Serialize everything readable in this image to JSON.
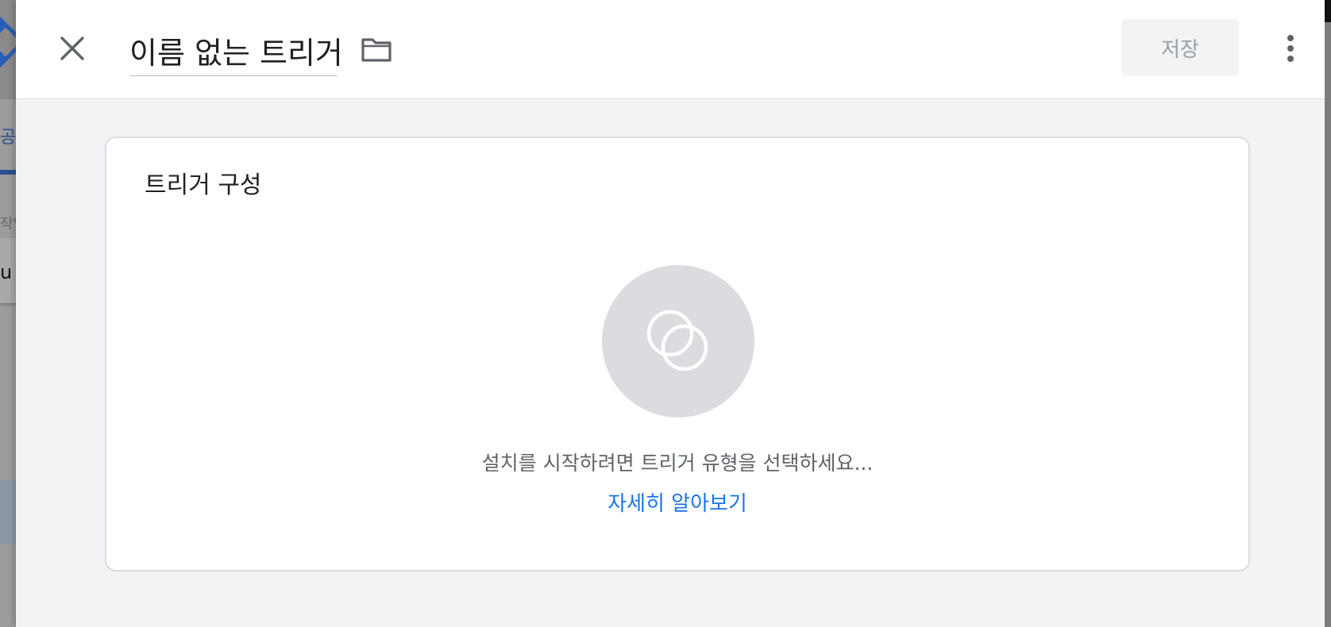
{
  "background": {
    "tab_fragment": "공",
    "label_fragment": "작업",
    "card_fragment": "u"
  },
  "header": {
    "close_icon": "close-icon",
    "title": "이름 없는 트리거",
    "folder_icon": "folder-icon",
    "save_label": "저장",
    "more_icon": "more-vert-icon"
  },
  "trigger_config": {
    "title": "트리거 구성",
    "empty_icon": "trigger-icon",
    "hint": "설치를 시작하려면 트리거 유형을 선택하세요...",
    "learn_more": "자세히 알아보기"
  },
  "colors": {
    "accent": "#1a73e8",
    "panel_bg": "#f1f3f4",
    "card_border": "#dadce0"
  }
}
